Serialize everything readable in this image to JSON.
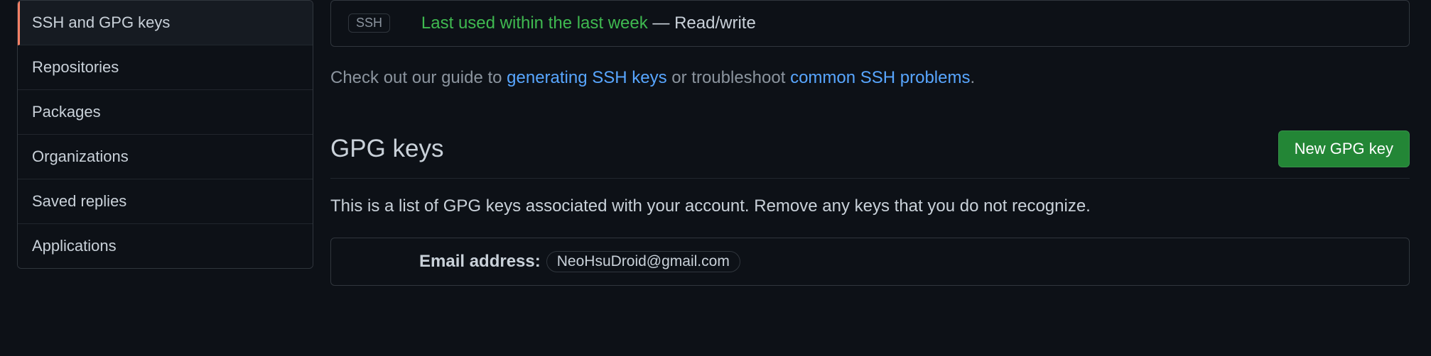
{
  "sidebar": {
    "items": [
      {
        "label": "SSH and GPG keys"
      },
      {
        "label": "Repositories"
      },
      {
        "label": "Packages"
      },
      {
        "label": "Organizations"
      },
      {
        "label": "Saved replies"
      },
      {
        "label": "Applications"
      }
    ]
  },
  "ssh": {
    "badge": "SSH",
    "last_used": "Last used within the last week",
    "access": " — Read/write"
  },
  "guide": {
    "prefix": "Check out our guide to ",
    "link1": "generating SSH keys",
    "middle": " or troubleshoot ",
    "link2": "common SSH problems",
    "suffix": "."
  },
  "gpg": {
    "title": "GPG keys",
    "button": "New GPG key",
    "description": "This is a list of GPG keys associated with your account. Remove any keys that you do not recognize.",
    "email_label": "Email address:",
    "email_value": "NeoHsuDroid@gmail.com"
  }
}
